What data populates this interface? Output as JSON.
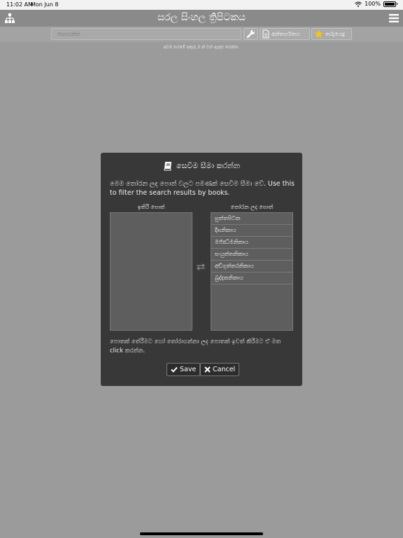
{
  "status_bar": {
    "time": "11:02 AM",
    "date": "Mon Jun 8",
    "battery": "100%"
  },
  "header": {
    "title": "සරල සිංහල ත්‍රිපිටකය"
  },
  "toolbar": {
    "search_placeholder": "සොයන්න",
    "contents_label": "අන්තර්ගතය",
    "stars_label": "තරුයෙදූ"
  },
  "hint": "අවම තරමේ අකුරු 2 ක් වත් ඇතුළු කරන්න.",
  "dialog": {
    "title": "සෙවීම සීමා කරන්න",
    "description": "මෙම තෝරන ලද පොත් වලට පමණක් සෙවීම සීමා වේ. Use this to filter the search results by books.",
    "left_header": "ඉතිරි පොත්",
    "right_header": "තෝරන ලද පොත්",
    "left_items": [],
    "right_items": [
      "සුත්තපිටක",
      "දීඝනිකාය",
      "මජ්ඣිමනිකාය",
      "සංයුත්තනිකාය",
      "අඞ්ගුත්තරනිකාය",
      "ඛුද්දකනිකාය"
    ],
    "footer": "පොතක් තේරීමට හෝ තෝරාගන්නා ලද පොතක් ඉවත් කිරීමට ඒ මත click කරන්න.",
    "save_label": "Save",
    "cancel_label": "Cancel"
  },
  "colors": {
    "background": "#9b9b9b",
    "dialog": "#383838",
    "star": "#f5c518"
  }
}
